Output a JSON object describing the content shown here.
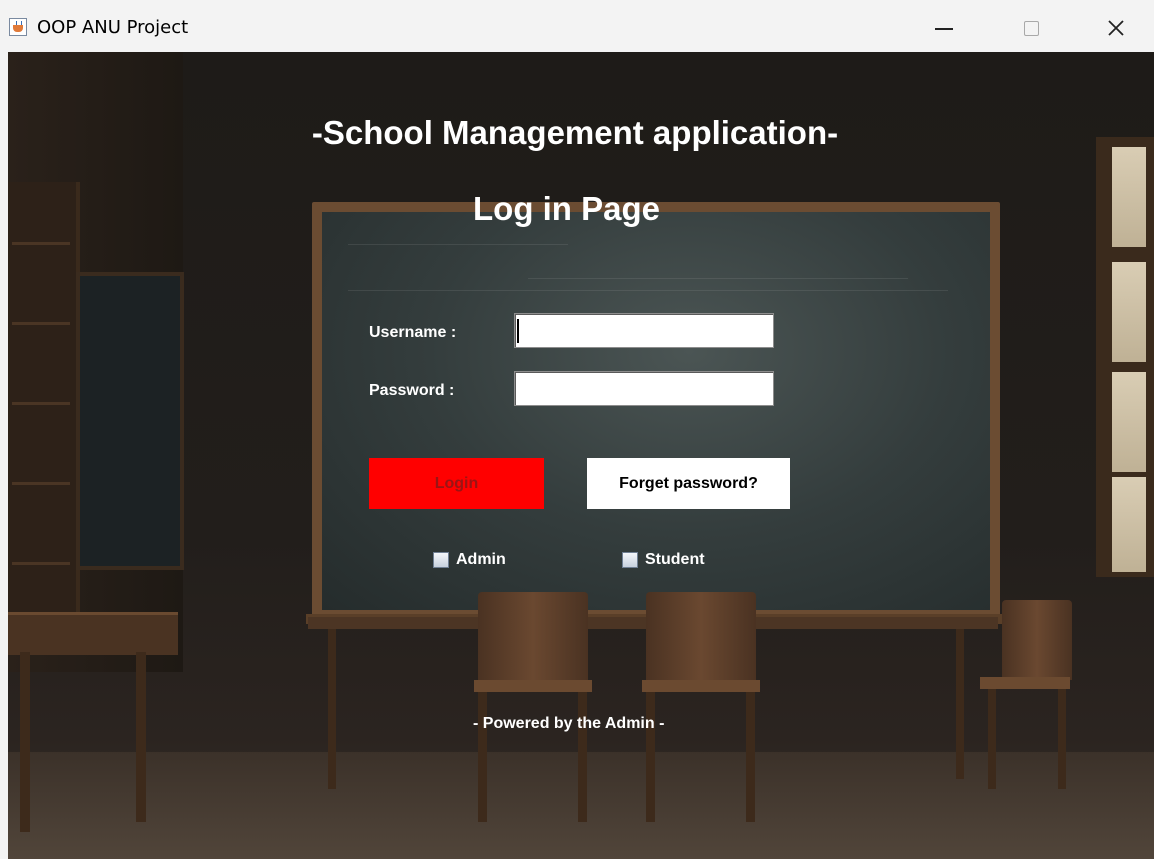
{
  "window": {
    "title": "OOP ANU Project",
    "controls": {
      "minimize": "minimize",
      "maximize": "maximize",
      "close": "✕"
    }
  },
  "header": {
    "app_title": "-School Management application-",
    "page_title": "Log in Page"
  },
  "form": {
    "username_label": "Username :",
    "username_value": "",
    "password_label": "Password :",
    "password_value": ""
  },
  "buttons": {
    "login": "Login",
    "forget_password": "Forget password?"
  },
  "roles": {
    "admin": {
      "label": "Admin",
      "checked": false
    },
    "student": {
      "label": "Student",
      "checked": false
    }
  },
  "footer": {
    "text": "- Powered by the Admin -"
  },
  "colors": {
    "login_button": "#ff0000",
    "forget_button": "#ffffff",
    "text": "#ffffff"
  }
}
